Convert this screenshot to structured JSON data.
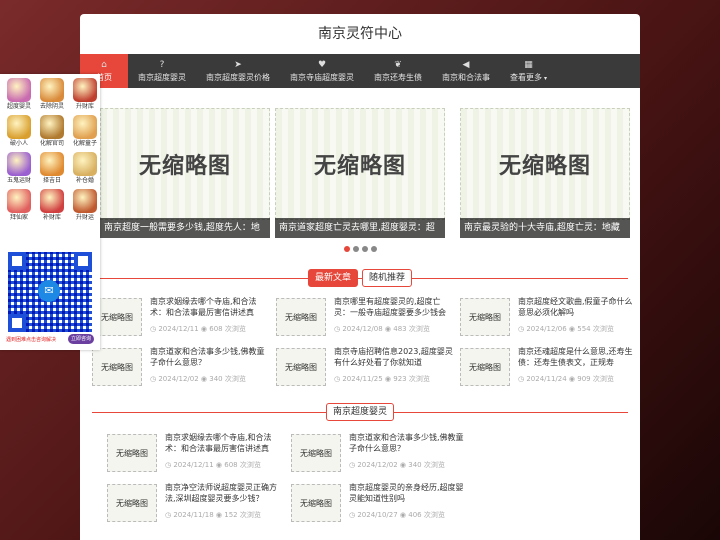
{
  "site": {
    "title": "南京灵符中心"
  },
  "nav": [
    {
      "label": "首页",
      "icon": "home-icon",
      "glyph": "⌂"
    },
    {
      "label": "南京超度婴灵",
      "icon": "question-icon",
      "glyph": "?"
    },
    {
      "label": "南京超度婴灵价格",
      "icon": "send-icon",
      "glyph": "➤"
    },
    {
      "label": "南京寺庙超度婴灵",
      "icon": "heart-icon",
      "glyph": "♥"
    },
    {
      "label": "南京还寿生债",
      "icon": "leaf-icon",
      "glyph": "❦"
    },
    {
      "label": "南京和合法事",
      "icon": "bullhorn-icon",
      "glyph": "◀"
    },
    {
      "label": "查看更多",
      "icon": "grid-icon",
      "glyph": "▦",
      "caret": "▾"
    }
  ],
  "slider": {
    "placeholder": "无缩略图",
    "slides": [
      {
        "caption": "南京超度一般需要多少钱,超度先人：地"
      },
      {
        "caption": "南京道家超度亡灵去哪里,超度婴灵：超"
      },
      {
        "caption": "南京最灵验的十大寺庙,超度亡灵：地藏"
      }
    ],
    "dots": 4
  },
  "section1": {
    "tabs": [
      "最新文章",
      "随机推荐"
    ],
    "articles": [
      {
        "title": "南京求姻缘去哪个寺庙,和合法术：和合法事最厉害信讲述真",
        "date": "2024/12/11",
        "views": "608 次浏览"
      },
      {
        "title": "南京哪里有超度婴灵的,超度亡灵：一般寺庙超度婴要多少钱会",
        "date": "2024/12/08",
        "views": "483 次浏览"
      },
      {
        "title": "南京超度经文歌曲,假童子命什么意思必须化解吗",
        "date": "2024/12/06",
        "views": "554 次浏览"
      },
      {
        "title": "南京道家和合法事多少钱,佛教童子命什么意思？",
        "date": "2024/12/02",
        "views": "340 次浏览"
      },
      {
        "title": "南京寺庙招聘信息2023,超度婴灵有什么好处看了你就知道",
        "date": "2024/11/25",
        "views": "923 次浏览"
      },
      {
        "title": "南京还魂超度是什么意思,还寿生债：还寿生债表文，正规寿",
        "date": "2024/11/24",
        "views": "909 次浏览"
      }
    ]
  },
  "section2": {
    "title": "南京超度婴灵",
    "articles": [
      {
        "title": "南京求姻缘去哪个寺庙,和合法术：和合法事最厉害信讲述真",
        "date": "2024/12/11",
        "views": "608 次浏览"
      },
      {
        "title": "南京道家和合法事多少钱,佛教童子命什么意思？",
        "date": "2024/12/02",
        "views": "340 次浏览"
      },
      {
        "title": "南京净空法师说超度婴灵正确方法,深圳超度婴灵要多少钱？",
        "date": "2024/11/18",
        "views": "152 次浏览"
      },
      {
        "title": "南京超度婴灵的亲身经历,超度婴灵能知道性别吗",
        "date": "2024/10/27",
        "views": "406 次浏览"
      }
    ]
  },
  "floatPanel": {
    "items": [
      {
        "label": "超度婴灵",
        "icon": "baby-spirit-icon",
        "color": "#c96bb0"
      },
      {
        "label": "去除阴灵",
        "icon": "ghost-icon",
        "color": "#d98a3a"
      },
      {
        "label": "升财库",
        "icon": "treasure-icon",
        "color": "#c04030"
      },
      {
        "label": "破小人",
        "icon": "villain-icon",
        "color": "#d9a030"
      },
      {
        "label": "化解官司",
        "icon": "lawsuit-icon",
        "color": "#b07a30"
      },
      {
        "label": "化解童子",
        "icon": "child-icon",
        "color": "#e0a050"
      },
      {
        "label": "五鬼运财",
        "icon": "wealth-icon",
        "color": "#9a5fd0"
      },
      {
        "label": "择吉日",
        "icon": "calendar-icon",
        "color": "#e08a30"
      },
      {
        "label": "补仓婚",
        "icon": "marriage-icon",
        "color": "#d8b060"
      },
      {
        "label": "拜仙家",
        "icon": "immortal-icon",
        "color": "#e06060"
      },
      {
        "label": "补财库",
        "icon": "coins-icon",
        "color": "#d04040"
      },
      {
        "label": "升财运",
        "icon": "fortune-icon",
        "color": "#c05a30"
      }
    ],
    "bottom_text": "遇到困难点击咨询解决",
    "button_label": "立即咨询"
  }
}
